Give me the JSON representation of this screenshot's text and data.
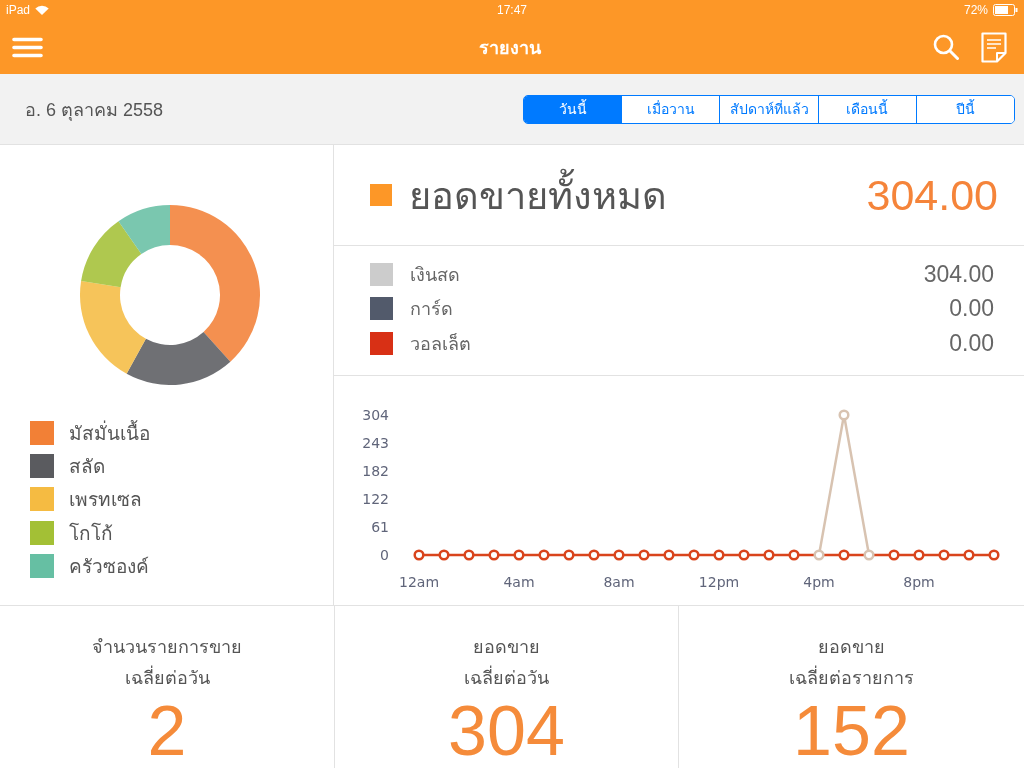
{
  "status_bar": {
    "device": "iPad",
    "time": "17:47",
    "battery": "72%"
  },
  "nav_bar": {
    "title": "รายงาน"
  },
  "date_bar": {
    "date": "อ. 6 ตุลาคม 2558",
    "periods": [
      {
        "label": "วันนี้",
        "selected": true
      },
      {
        "label": "เมื่อวาน",
        "selected": false
      },
      {
        "label": "สัปดาห์ที่แล้ว",
        "selected": false
      },
      {
        "label": "เดือนนี้",
        "selected": false
      },
      {
        "label": "ปีนี้",
        "selected": false
      }
    ]
  },
  "category_legend": [
    {
      "label": "มัสมั่นเนื้อ",
      "color": "#f28036"
    },
    {
      "label": "สลัด",
      "color": "#5a5b5f"
    },
    {
      "label": "เพรทเซล",
      "color": "#f5bb42"
    },
    {
      "label": "โกโก้",
      "color": "#a3c035"
    },
    {
      "label": "ครัวซองค์",
      "color": "#66bfa3"
    }
  ],
  "total_sales": {
    "label": "ยอดขายทั้งหมด",
    "value": "304.00"
  },
  "payments": [
    {
      "label": "เงินสด",
      "value": "304.00",
      "color": "#cccccc"
    },
    {
      "label": "การ์ด",
      "value": "0.00",
      "color": "#525a6b"
    },
    {
      "label": "วอลเล็ต",
      "value": "0.00",
      "color": "#d83015"
    }
  ],
  "hourly_chart": {
    "chart_data": [
      {
        "type": "line",
        "categories": [
          "12am",
          null,
          null,
          null,
          "4am",
          null,
          null,
          null,
          "8am",
          null,
          null,
          null,
          "12pm",
          null,
          null,
          null,
          "4pm",
          null,
          null,
          null,
          "8pm",
          null,
          null,
          null
        ],
        "yticks": [
          0,
          61,
          122,
          182,
          243,
          304
        ],
        "ylim": [
          0,
          304
        ],
        "marker": "circle",
        "series": [
          {
            "color": "#d9441c",
            "values": [
              0,
              0,
              0,
              0,
              0,
              0,
              0,
              0,
              0,
              0,
              0,
              0,
              0,
              0,
              0,
              0,
              0,
              0,
              0,
              0,
              0,
              0,
              0,
              0
            ]
          },
          {
            "color": "#d8c3b1",
            "values": [
              null,
              null,
              null,
              null,
              null,
              null,
              null,
              null,
              null,
              null,
              null,
              null,
              null,
              null,
              null,
              null,
              0,
              304,
              0,
              null,
              null,
              null,
              null,
              null
            ]
          }
        ]
      }
    ]
  },
  "averages": [
    {
      "label": "จำนวนรายการขาย\nเฉลี่ยต่อวัน",
      "value": "2"
    },
    {
      "label": "ยอดขาย\nเฉลี่ยต่อวัน",
      "value": "304"
    },
    {
      "label": "ยอดขาย\nเฉลี่ยต่อรายการ",
      "value": "152"
    }
  ]
}
